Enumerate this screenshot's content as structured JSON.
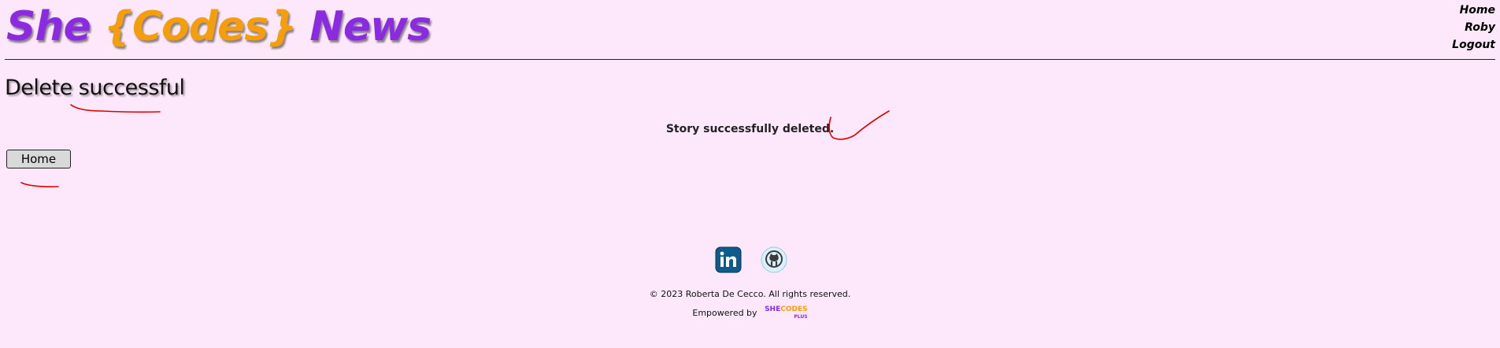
{
  "header": {
    "logo": {
      "she": "She",
      "codes": "{Codes}",
      "news": "News"
    },
    "nav": {
      "home": "Home",
      "user": "Roby",
      "logout": "Logout"
    }
  },
  "main": {
    "heading": "Delete successful",
    "message": "Story successfully deleted.",
    "home_button": "Home"
  },
  "footer": {
    "social_icons": [
      "linkedin-icon",
      "github-icon"
    ],
    "copyright": "© 2023 Roberta De Cecco. All rights reserved.",
    "powered_by": "Empowered by",
    "powered_logo": {
      "part1": "SHE",
      "part2": "CODES",
      "part3": "PLUS"
    }
  },
  "colors": {
    "background": "#fde8fb",
    "brand_purple": "#8a2be2",
    "brand_orange": "#f59e0b",
    "annotation_red": "#e00000",
    "linkedin_blue": "#0a66c2"
  }
}
